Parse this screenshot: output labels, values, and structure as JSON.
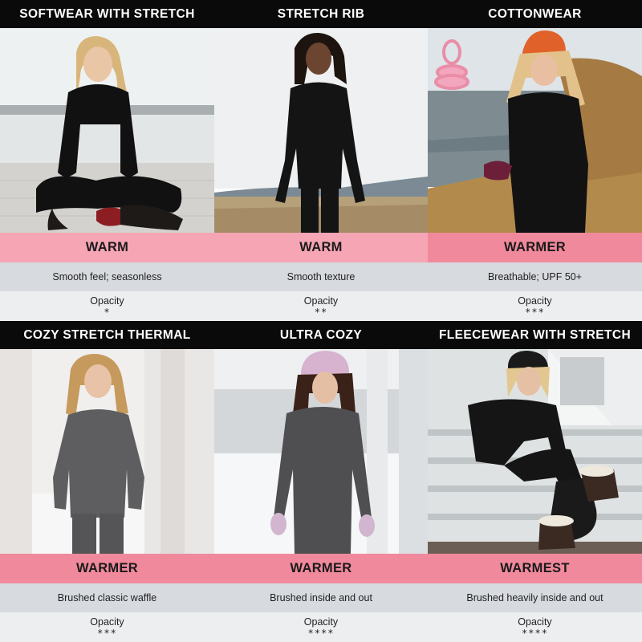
{
  "opacity_label": "Opacity",
  "colors": {
    "title_bg": "#0a0a0a",
    "warm_pink": "#f5a5b4",
    "warmest_pink": "#f0899c",
    "feature_gray": "#d7dadf",
    "opacity_gray": "#eceef0"
  },
  "products": [
    {
      "title": "SOFTWEAR WITH STRETCH",
      "warmth": "WARM",
      "feature": "Smooth feel; seasonless",
      "opacity_stars": "*",
      "opacity_level": 1,
      "photo": "woman-sitting-cross-legged-photo"
    },
    {
      "title": "STRETCH RIB",
      "warmth": "WARM",
      "feature": "Smooth texture",
      "opacity_stars": "**",
      "opacity_level": 2,
      "photo": "woman-standing-lakeside-photo"
    },
    {
      "title": "COTTONWEAR",
      "warmth": "WARMER",
      "feature": "Breathable; UPF 50+",
      "opacity_stars": "***",
      "opacity_level": 3,
      "photo": "woman-orange-beanie-photo"
    },
    {
      "title": "COZY STRETCH THERMAL",
      "warmth": "WARMER",
      "feature": "Brushed classic waffle",
      "opacity_stars": "***",
      "opacity_level": 3,
      "photo": "woman-gray-thermal-porch-photo"
    },
    {
      "title": "ULTRA COZY",
      "warmth": "WARMER",
      "feature": "Brushed inside and out",
      "opacity_stars": "****",
      "opacity_level": 4,
      "photo": "woman-pink-beanie-snow-photo"
    },
    {
      "title": "FLEECEWEAR WITH STRETCH",
      "warmth": "WARMEST",
      "feature": "Brushed heavily inside and out",
      "opacity_stars": "****",
      "opacity_level": 4,
      "photo": "woman-sitting-steps-boots-photo"
    }
  ]
}
